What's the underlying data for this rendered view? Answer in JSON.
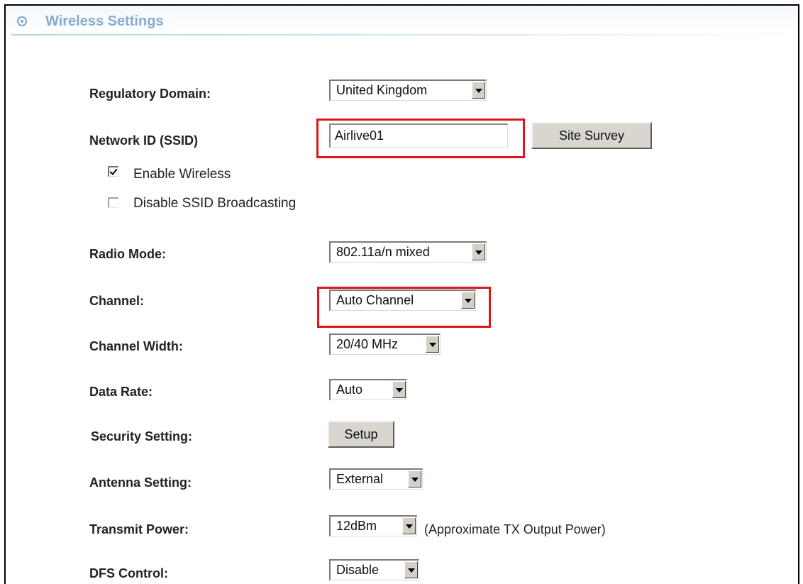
{
  "header": {
    "title": "Wireless Settings",
    "icon": "target-circle-icon"
  },
  "form": {
    "regulatory_domain": {
      "label": "Regulatory Domain:",
      "value": "United Kingdom"
    },
    "ssid": {
      "label": "Network ID (SSID)",
      "value": "Airlive01",
      "site_survey_label": "Site Survey"
    },
    "enable_wireless": {
      "label": "Enable Wireless",
      "checked": true
    },
    "disable_ssid_broadcast": {
      "label": "Disable SSID Broadcasting",
      "checked": false
    },
    "radio_mode": {
      "label": "Radio Mode:",
      "value": "802.11a/n mixed"
    },
    "channel": {
      "label": "Channel:",
      "value": "Auto Channel"
    },
    "channel_width": {
      "label": "Channel Width:",
      "value": "20/40 MHz"
    },
    "data_rate": {
      "label": "Data Rate:",
      "value": "Auto"
    },
    "security_setting": {
      "label": "Security Setting:",
      "button_label": "Setup"
    },
    "antenna_setting": {
      "label": "Antenna Setting:",
      "value": "External"
    },
    "transmit_power": {
      "label": "Transmit Power:",
      "value": "12dBm",
      "note": "(Approximate TX Output Power)"
    },
    "dfs_control": {
      "label": "DFS Control:",
      "value": "Disable"
    }
  },
  "colors": {
    "header_title": "#86abcf",
    "highlight_box": "#e0151b",
    "button_face": "#d9d6cf"
  }
}
